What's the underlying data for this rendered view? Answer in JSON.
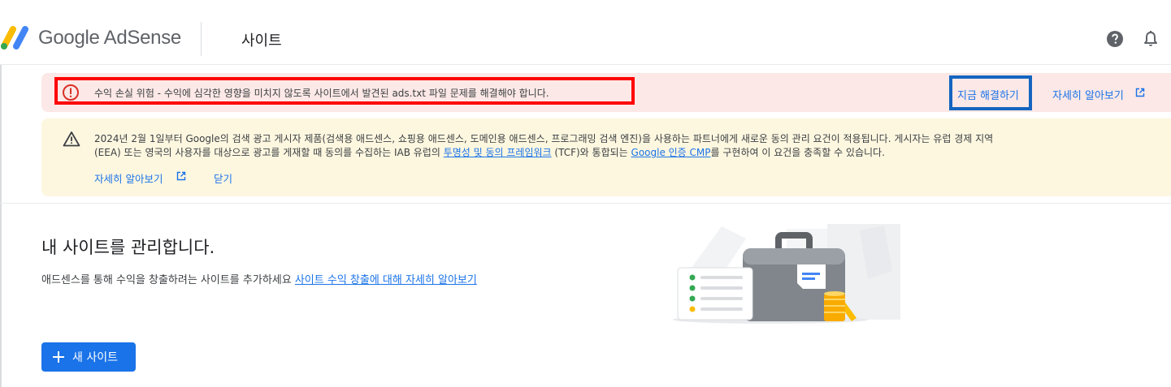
{
  "header": {
    "brand": "Google AdSense",
    "page_title": "사이트",
    "icons": [
      "adsense-logo-icon",
      "help-icon",
      "bell-icon"
    ]
  },
  "risk_banner": {
    "message": "수익 손실 위험 - 수익에 심각한 영향을 미치지 않도록 사이트에서 발견된 ads.txt 파일 문제를 해결해야 합니다.",
    "fix_label": "지금 해결하기",
    "learn_more_label": "자세히 알아보기",
    "highlight_colors": {
      "message_box": "#ff0000",
      "action_box": "#1565c0"
    },
    "icons": [
      "error-circle-icon",
      "external-link-icon"
    ]
  },
  "notice": {
    "line1": "2024년 2월 1일부터 Google의 검색 광고 게시자 제품(검색용 애드센스, 쇼핑용 애드센스, 도메인용 애드센스, 프로그래밍 검색 엔진)을 사용하는 파트너에게 새로운 동의 관리 요건이 적용됩니다. 게시자는 유럽 경제 지역",
    "line2_a": "(EEA) 또는 영국의 사용자를 대상으로 광고를 게재할 때 동의를 수집하는 IAB 유럽의 ",
    "link_tcf": "투명성 및 동의 프레임워크",
    "line2_b": " (TCF)와 통합되는 ",
    "link_cmp": "Google 인증 CMP",
    "line2_c": "를 구현하여 이 요건을 충족할 수 있습니다.",
    "learn_more_label": "자세히 알아보기",
    "close_label": "닫기",
    "icons": [
      "warning-triangle-icon",
      "external-link-icon"
    ]
  },
  "main": {
    "heading": "내 사이트를 관리합니다.",
    "desc_text": "애드센스를 통해 수익을 창출하려는 사이트를 추가하세요 ",
    "desc_link": "사이트 수익 창출에 대해 자세히 알아보기",
    "new_site_label": "새 사이트",
    "icons": [
      "briefcase-illustration",
      "plus-icon"
    ]
  },
  "colors": {
    "accent": "#1a73e8",
    "risk_bg": "#fce8e6",
    "risk_icon": "#d93025",
    "notice_bg": "#fef7e0"
  }
}
